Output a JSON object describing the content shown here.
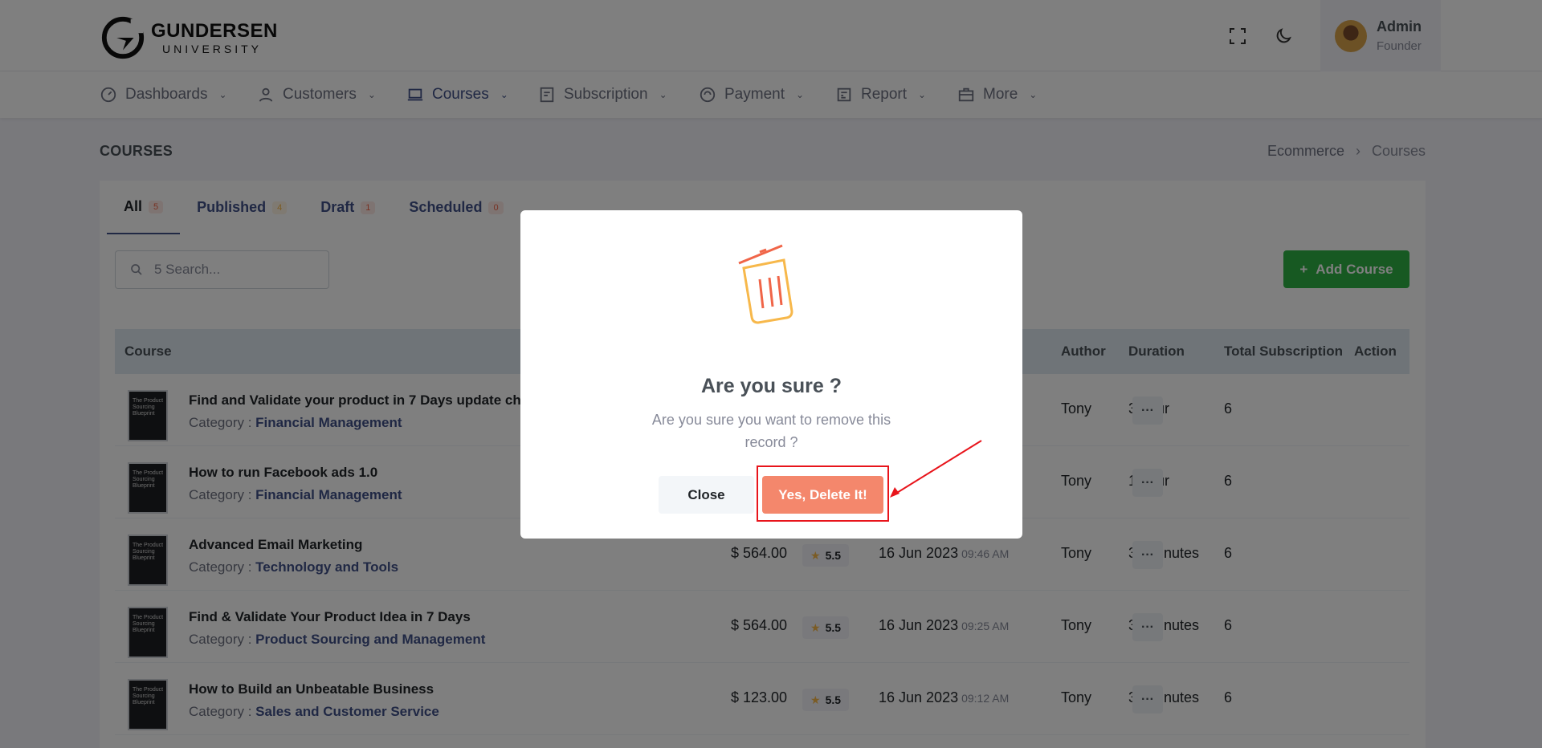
{
  "brand": {
    "title": "GUNDERSEN",
    "subtitle": "UNIVERSITY"
  },
  "header": {
    "user_name": "Admin",
    "user_role": "Founder",
    "icons": [
      "fullscreen-icon",
      "moon-icon"
    ]
  },
  "nav": [
    {
      "label": "Dashboards",
      "icon": "dashboard-icon",
      "active": false
    },
    {
      "label": "Customers",
      "icon": "user-icon",
      "active": false
    },
    {
      "label": "Courses",
      "icon": "laptop-icon",
      "active": true
    },
    {
      "label": "Subscription",
      "icon": "subscription-icon",
      "active": false
    },
    {
      "label": "Payment",
      "icon": "payment-icon",
      "active": false
    },
    {
      "label": "Report",
      "icon": "report-icon",
      "active": false
    },
    {
      "label": "More",
      "icon": "briefcase-icon",
      "active": false
    }
  ],
  "page": {
    "title": "COURSES",
    "breadcrumb": [
      "Ecommerce",
      "Courses"
    ]
  },
  "tabs": [
    {
      "label": "All",
      "count": "5"
    },
    {
      "label": "Published",
      "count": "4"
    },
    {
      "label": "Draft",
      "count": "1"
    },
    {
      "label": "Scheduled",
      "count": "0"
    }
  ],
  "search": {
    "placeholder": "5 Search..."
  },
  "add_button": "Add Course",
  "table": {
    "headers": [
      "Course",
      "Author",
      "Duration",
      "Total Subscription",
      "Action"
    ],
    "category_label": "Category :",
    "thumb_text": "The Product Sourcing Blueprint",
    "rows": [
      {
        "title": "Find and Validate your product in 7 Days update ch",
        "category": "Financial Management",
        "price": "",
        "rating": "",
        "date": "",
        "time": "",
        "author": "Tony",
        "duration": "3 hour",
        "subs": "6"
      },
      {
        "title": "How to run Facebook ads 1.0",
        "category": "Financial Management",
        "price": "",
        "rating": "",
        "date": "",
        "time": "",
        "author": "Tony",
        "duration": "1 hour",
        "subs": "6"
      },
      {
        "title": "Advanced Email Marketing",
        "category": "Technology and Tools",
        "price": "$ 564.00",
        "rating": "5.5",
        "date": "16 Jun 2023",
        "time": "09:46 AM",
        "author": "Tony",
        "duration": "30 minutes",
        "subs": "6"
      },
      {
        "title": "Find & Validate Your Product Idea in 7 Days",
        "category": "Product Sourcing and Management",
        "price": "$ 564.00",
        "rating": "5.5",
        "date": "16 Jun 2023",
        "time": "09:25 AM",
        "author": "Tony",
        "duration": "30 minutes",
        "subs": "6"
      },
      {
        "title": "How to Build an Unbeatable Business",
        "category": "Sales and Customer Service",
        "price": "$ 123.00",
        "rating": "5.5",
        "date": "16 Jun 2023",
        "time": "09:12 AM",
        "author": "Tony",
        "duration": "30 minutes",
        "subs": "6"
      }
    ]
  },
  "modal": {
    "icon": "trash-icon",
    "title": "Are you sure ?",
    "message": "Are you sure you want to remove this record ?",
    "close_label": "Close",
    "confirm_label": "Yes, Delete It!"
  },
  "colors": {
    "primary": "#405189",
    "success": "#2fb344",
    "danger": "#f4876c",
    "annotation": "#e8141b"
  }
}
